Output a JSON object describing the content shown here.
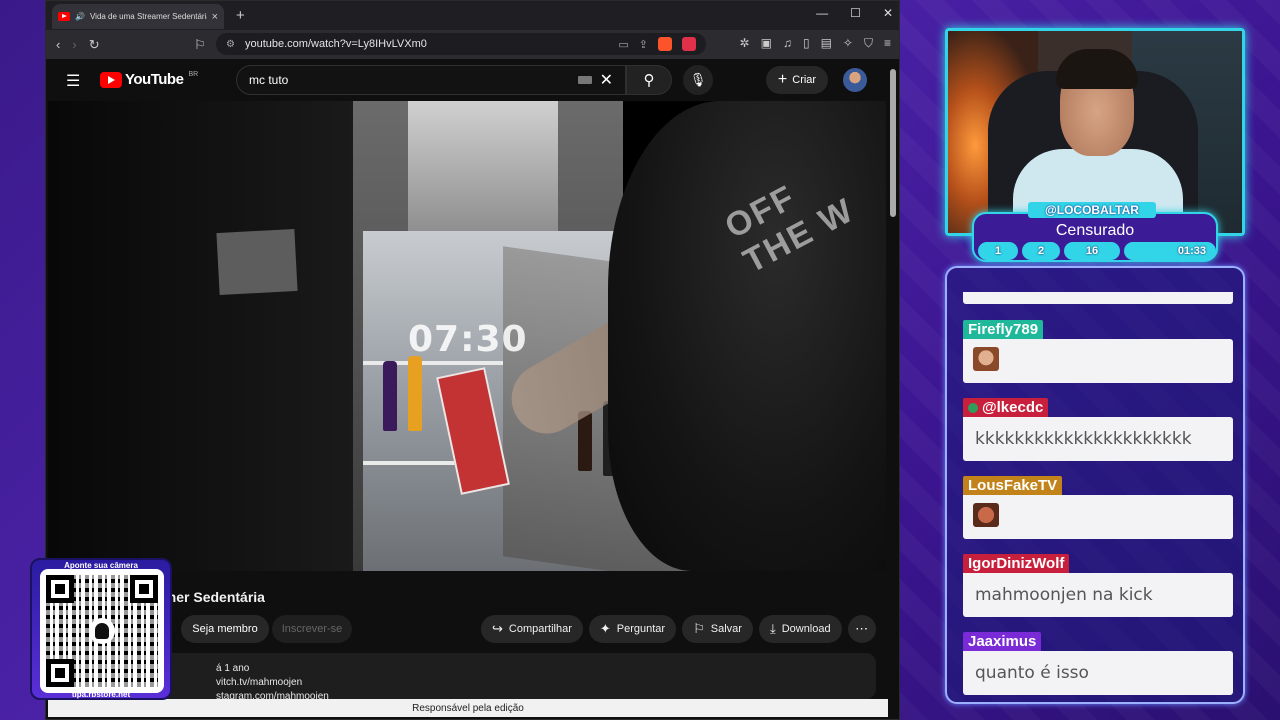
{
  "browser": {
    "tab_title": "Vida de uma Streamer Sedentária",
    "url": "youtube.com/watch?v=Ly8IHvLVXm0",
    "status_text": "Responsável pela edição"
  },
  "youtube": {
    "logo_text": "YouTube",
    "region": "BR",
    "search_value": "mc tuto",
    "create_label": "Criar",
    "video_timer": "07:30",
    "shirt_text": "OFF THE W",
    "video_title": "amer Sedentária",
    "member_label": "Seja membro",
    "subscribe_label": "Inscrever-se",
    "actions": [
      {
        "icon": "share-icon",
        "label": "Compartilhar"
      },
      {
        "icon": "sparkle-icon",
        "label": "Perguntar"
      },
      {
        "icon": "bookmark-icon",
        "label": "Salvar"
      },
      {
        "icon": "download-icon",
        "label": "Download"
      }
    ],
    "description": {
      "line1": "á 1 ano",
      "line2": "vitch.tv/mahmoojen",
      "line3": "stagram.com/mahmoojen"
    }
  },
  "qr": {
    "top_text": "Aponte sua câmera",
    "bottom_text": "tipa.rbstore.net"
  },
  "streamer": {
    "handle": "@LOCOBALTAR",
    "status": "Censurado",
    "stats": [
      "1",
      "2",
      "16",
      "01:33"
    ]
  },
  "chat": {
    "messages": [
      {
        "user": "Firefly789",
        "text": "",
        "color": "#1fb89a",
        "emote": "emote-a"
      },
      {
        "user": "@lkecdc",
        "text": "kkkkkkkkkkkkkkkkkkkkkk",
        "color": "#c8203c"
      },
      {
        "user": "LousFakeTV",
        "text": "",
        "color": "#c2841a",
        "emote": "emote-b"
      },
      {
        "user": "IgorDinizWolf",
        "text": "mahmoonjen na kick",
        "color": "#c8203c"
      },
      {
        "user": "Jaaximus",
        "text": "quanto é isso",
        "color": "#7a2ad6"
      }
    ]
  }
}
